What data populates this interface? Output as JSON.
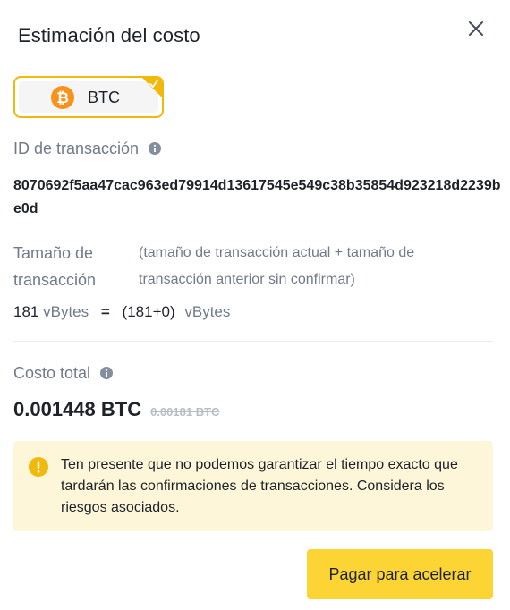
{
  "dialog": {
    "title": "Estimación del costo",
    "close_icon": "close-icon"
  },
  "coin": {
    "label": "BTC",
    "icon": "bitcoin-icon",
    "selected": true,
    "accent": "#f0b90b"
  },
  "transaction_id": {
    "label": "ID de transacción",
    "value": "8070692f5aa47cac963ed79914d13617545e549c38b35854d923218d2239be0d"
  },
  "transaction_size": {
    "label": "Tamaño de transacción",
    "note": "(tamaño de transacción actual + tamaño de transacción anterior sin confirmar)",
    "value": "181",
    "unit": "vBytes",
    "equals": "=",
    "breakdown": "(181+0)",
    "breakdown_unit": "vBytes"
  },
  "total_cost": {
    "label": "Costo total",
    "current": "0.001448 BTC",
    "previous": "0.00181 BTC"
  },
  "notice": {
    "text": "Ten presente que no podemos garantizar el tiempo exacto que tardarán las confirmaciones de transacciones. Considera los riesgos asociados.",
    "background": "#fef6d8",
    "icon_color": "#f0b90b"
  },
  "actions": {
    "primary_label": "Pagar para acelerar",
    "primary_color": "#fcd535"
  }
}
